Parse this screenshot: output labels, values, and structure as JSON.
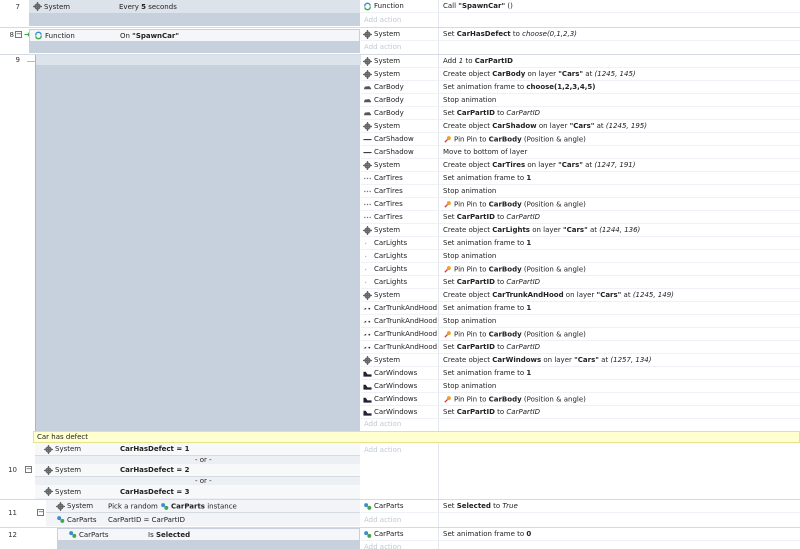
{
  "events": {
    "e7": {
      "num": "7",
      "cond_obj": "System",
      "cond_text_pre": "Every ",
      "cond_text_b": "5",
      "cond_text_post": " seconds",
      "actions": [
        {
          "obj": "Function",
          "pre": "Call ",
          "b": "\"SpawnCar\"",
          "post": " ()"
        }
      ],
      "add_action": "Add action"
    },
    "e8": {
      "num": "8",
      "cond_obj": "Function",
      "cond_text_pre": "On ",
      "cond_text_b": "\"SpawnCar\"",
      "actions": [
        {
          "obj": "System",
          "pre": "Set ",
          "b": "CarHasDefect",
          "post": " to ",
          "it": "choose(0,1,2,3)"
        }
      ],
      "add_action": "Add action"
    },
    "e9": {
      "num": "9",
      "actions": [
        {
          "obj": "System",
          "text": "Add 1 to CarPartID"
        },
        {
          "obj": "System",
          "text": "Create object CarBody on layer \"Cars\" at (1245, 145)"
        },
        {
          "obj": "CarBody",
          "text": "Set animation frame to choose(1,2,3,4,5)"
        },
        {
          "obj": "CarBody",
          "text": "Stop animation"
        },
        {
          "obj": "CarBody",
          "text": "Set CarPartID to CarPartID"
        },
        {
          "obj": "System",
          "text": "Create object CarShadow on layer \"Cars\" at (1245, 195)"
        },
        {
          "obj": "CarShadow",
          "text": "Pin Pin to CarBody (Position & angle)"
        },
        {
          "obj": "CarShadow",
          "text": "Move to bottom of layer"
        },
        {
          "obj": "System",
          "text": "Create object CarTires on layer \"Cars\" at (1247, 191)"
        },
        {
          "obj": "CarTires",
          "text": "Set animation frame to 1"
        },
        {
          "obj": "CarTires",
          "text": "Stop animation"
        },
        {
          "obj": "CarTires",
          "text": "Pin Pin to CarBody (Position & angle)"
        },
        {
          "obj": "CarTires",
          "text": "Set CarPartID to CarPartID"
        },
        {
          "obj": "System",
          "text": "Create object CarLights on layer \"Cars\" at (1244, 136)"
        },
        {
          "obj": "CarLights",
          "text": "Set animation frame to 1"
        },
        {
          "obj": "CarLights",
          "text": "Stop animation"
        },
        {
          "obj": "CarLights",
          "text": "Pin Pin to CarBody (Position & angle)"
        },
        {
          "obj": "CarLights",
          "text": "Set CarPartID to CarPartID"
        },
        {
          "obj": "System",
          "text": "Create object CarTrunkAndHood on layer \"Cars\" at (1245, 149)"
        },
        {
          "obj": "CarTrunkAndHood",
          "text": "Set animation frame to 1"
        },
        {
          "obj": "CarTrunkAndHood",
          "text": "Stop animation"
        },
        {
          "obj": "CarTrunkAndHood",
          "text": "Pin Pin to CarBody (Position & angle)"
        },
        {
          "obj": "CarTrunkAndHood",
          "text": "Set CarPartID to CarPartID"
        },
        {
          "obj": "System",
          "text": "Create object CarWindows on layer \"Cars\" at (1257, 134)"
        },
        {
          "obj": "CarWindows",
          "text": "Set animation frame to 1"
        },
        {
          "obj": "CarWindows",
          "text": "Stop animation"
        },
        {
          "obj": "CarWindows",
          "text": "Pin Pin to CarBody (Position & angle)"
        },
        {
          "obj": "CarWindows",
          "text": "Set CarPartID to CarPartID"
        }
      ],
      "add_action": "Add action"
    },
    "comment": "Car has defect",
    "e10": {
      "num": "10",
      "conds": [
        {
          "obj": "System",
          "text": "CarHasDefect = 1"
        },
        {
          "obj": "System",
          "text": "CarHasDefect = 2"
        },
        {
          "obj": "System",
          "text": "CarHasDefect = 3"
        }
      ],
      "or_label": "- or -",
      "add_action": "Add action"
    },
    "e11": {
      "num": "11",
      "cond1_obj": "System",
      "cond1_pre": "Pick a random ",
      "cond1_b": "CarParts",
      "cond1_post": " instance",
      "cond2_obj": "CarParts",
      "cond2_text": "CarPartID = CarPartID",
      "action_obj": "CarParts",
      "action_pre": "Set ",
      "action_b": "Selected",
      "action_mid": " to ",
      "action_it": "True",
      "add_action": "Add action"
    },
    "e12": {
      "num": "12",
      "cond_obj": "CarParts",
      "cond_pre": "Is ",
      "cond_b": "Selected",
      "action_obj": "CarParts",
      "action_pre": "Set animation frame to ",
      "action_b": "0",
      "add_action": "Add action"
    }
  },
  "colors": {
    "condition_bg": "#c7d1de",
    "comment_bg": "#ffffcf",
    "add_action_text": "#c3c9d2"
  }
}
